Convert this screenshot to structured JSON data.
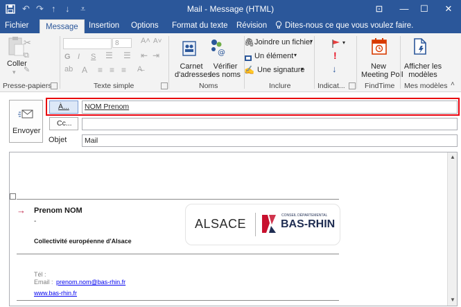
{
  "window": {
    "title": "Mail - Message (HTML)",
    "minimize_glyph": "—",
    "restore_glyph": "☐",
    "close_glyph": "✕",
    "ribbon_display_glyph": "⊡"
  },
  "qat": {
    "undo_glyph": "↶",
    "redo_glyph": "↷",
    "up_glyph": "↑",
    "down_glyph": "↓",
    "more_glyph": "⩡"
  },
  "tabs": [
    {
      "label": "Fichier"
    },
    {
      "label": "Message"
    },
    {
      "label": "Insertion"
    },
    {
      "label": "Options"
    },
    {
      "label": "Format du texte"
    },
    {
      "label": "Révision"
    }
  ],
  "tell_me": "Dites-nous ce que vous voulez faire.",
  "ribbon": {
    "clipboard": {
      "paste_label": "Coller",
      "group_label": "Presse-papiers"
    },
    "basic_text": {
      "font_size": "8",
      "bold": "G",
      "italic": "I",
      "underline": "S",
      "group_label": "Texte simple"
    },
    "names": {
      "address_book": "Carnet\nd'adresses",
      "check_names": "Vérifier\nles noms",
      "group_label": "Noms"
    },
    "include": {
      "attach_file": "Joindre un fichier",
      "item": "Un élément",
      "signature": "Une signature",
      "group_label": "Inclure"
    },
    "tags": {
      "group_label": "Indicat..."
    },
    "findtime": {
      "new_meeting_poll": "New\nMeeting Poll",
      "group_label": "FindTime"
    },
    "my_templates": {
      "show_templates": "Afficher les\nmodèles",
      "group_label": "Mes modèles"
    }
  },
  "header": {
    "send_label": "Envoyer",
    "to_button": "À...",
    "to_value": "NOM Prenom",
    "cc_button": "Cc...",
    "cc_value": "",
    "subject_label": "Objet",
    "subject_value": "Mail"
  },
  "signature": {
    "arrow": "→",
    "name": "Prenom NOM",
    "dash": "-",
    "org": "Collectivité européenne d'Alsace",
    "logo_left": "ALSACE",
    "logo_conseil": "CONSEIL DÉPARTEMENTAL",
    "logo_right": "Bas-Rhin",
    "tel_label": "Tél :",
    "email_label": "Email :",
    "email_value": "prenom.nom@bas-rhin.fr",
    "website": "www.bas-rhin.fr"
  },
  "colors": {
    "accent": "#2b579a",
    "highlight_box": "#e8000c",
    "logo_red": "#c8102e",
    "arrow": "#c0264a"
  }
}
